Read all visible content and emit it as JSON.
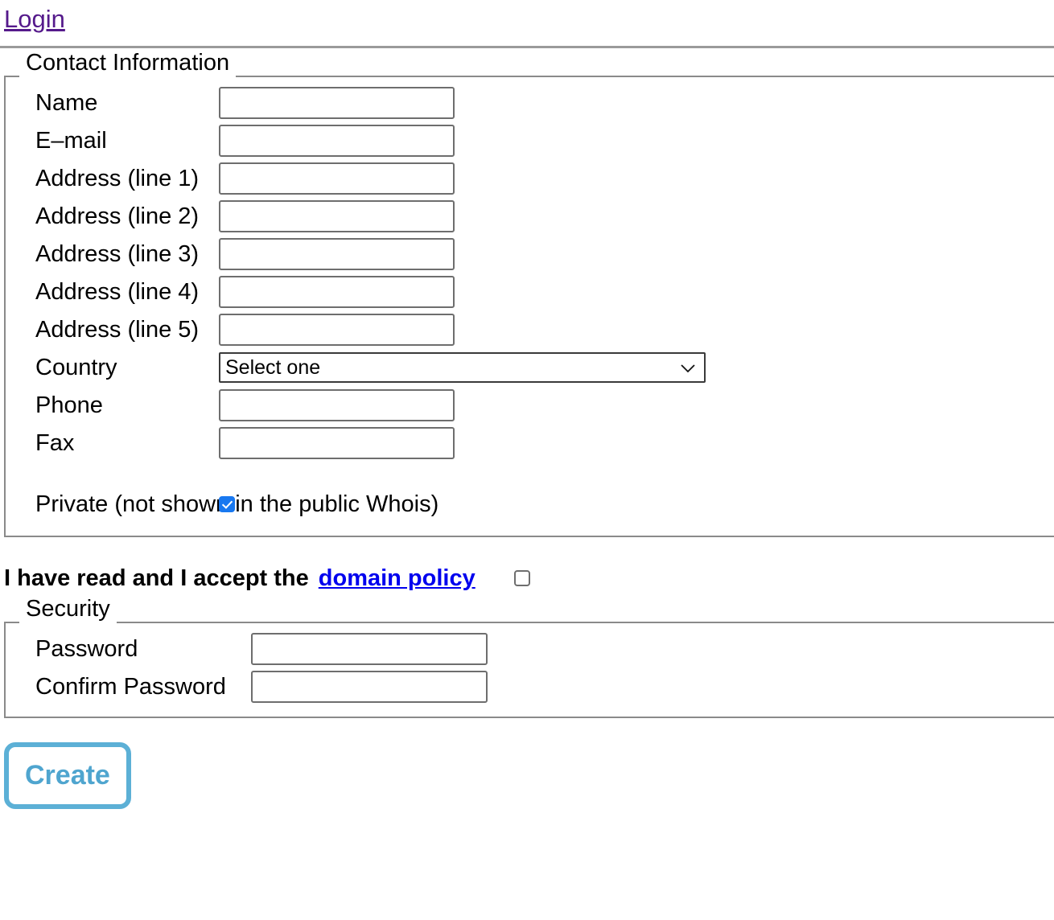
{
  "header": {
    "login_label": "Login"
  },
  "contact": {
    "legend": "Contact Information",
    "fields": [
      {
        "label": "Name",
        "value": "",
        "placeholder": ""
      },
      {
        "label": "E–mail",
        "value": "",
        "placeholder": ""
      },
      {
        "label": "Address (line 1)",
        "value": "",
        "placeholder": ""
      },
      {
        "label": "Address (line 2)",
        "value": "",
        "placeholder": ""
      },
      {
        "label": "Address (line 3)",
        "value": "",
        "placeholder": ""
      },
      {
        "label": "Address (line 4)",
        "value": "",
        "placeholder": ""
      },
      {
        "label": "Address (line 5)",
        "value": "",
        "placeholder": ""
      }
    ],
    "country": {
      "label": "Country",
      "selected": "Select one",
      "chevron": "⌄"
    },
    "phone": {
      "label": "Phone",
      "value": "",
      "placeholder": ""
    },
    "fax": {
      "label": "Fax",
      "value": "",
      "placeholder": ""
    },
    "private": {
      "label": "Private (not shown in the public Whois)",
      "checked": "true"
    }
  },
  "policy": {
    "text": "I have read and I accept the",
    "link_label": "domain policy",
    "checked": "false"
  },
  "security": {
    "legend": "Security",
    "password": {
      "label": "Password",
      "value": "",
      "placeholder": ""
    },
    "confirm": {
      "label": "Confirm Password",
      "value": "",
      "placeholder": ""
    }
  },
  "actions": {
    "create_label": "Create"
  },
  "colors": {
    "visited_link": "#551A8B",
    "link": "#0000EE",
    "checkbox_checked": "#1878f0",
    "button_accent": "#5cb0d6",
    "border": "#8a8a8a"
  }
}
